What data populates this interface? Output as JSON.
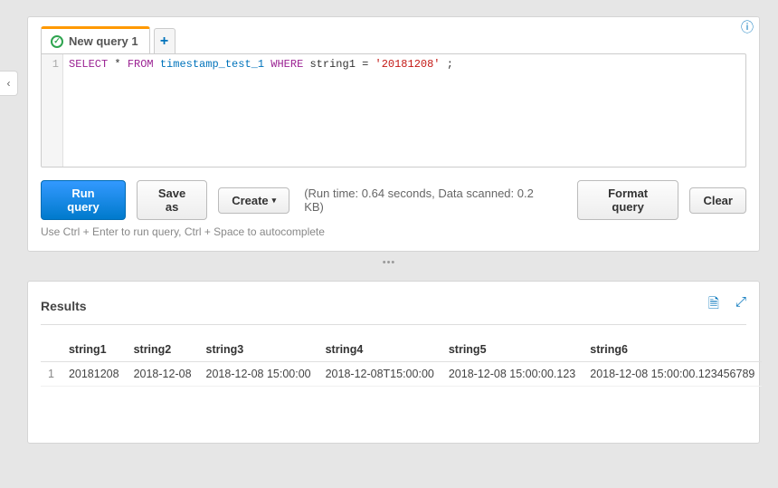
{
  "collapse_glyph": "‹",
  "info_glyph": "ⓘ",
  "tabs": {
    "active_label": "New query 1",
    "add_glyph": "+"
  },
  "editor": {
    "line_number": "1",
    "sql": {
      "kw_select": "SELECT",
      "star": " * ",
      "kw_from": "FROM",
      "table": " timestamp_test_1 ",
      "kw_where": "WHERE",
      "col": " string1 = ",
      "str": "'20181208'",
      "tail": " ;"
    }
  },
  "buttons": {
    "run": "Run query",
    "save_as": "Save as",
    "create": "Create",
    "format": "Format query",
    "clear": "Clear"
  },
  "run_info": "(Run time: 0.64 seconds, Data scanned: 0.2 KB)",
  "hint": "Use Ctrl + Enter to run query, Ctrl + Space to autocomplete",
  "splitter_glyph": "•••",
  "results": {
    "title": "Results",
    "download_glyph": "🗎",
    "expand_glyph": "⤢",
    "columns": [
      "",
      "string1",
      "string2",
      "string3",
      "string4",
      "string5",
      "string6"
    ],
    "rows": [
      [
        "1",
        "20181208",
        "2018-12-08",
        "2018-12-08 15:00:00",
        "2018-12-08T15:00:00",
        "2018-12-08 15:00:00.123",
        "2018-12-08 15:00:00.123456789"
      ]
    ]
  }
}
